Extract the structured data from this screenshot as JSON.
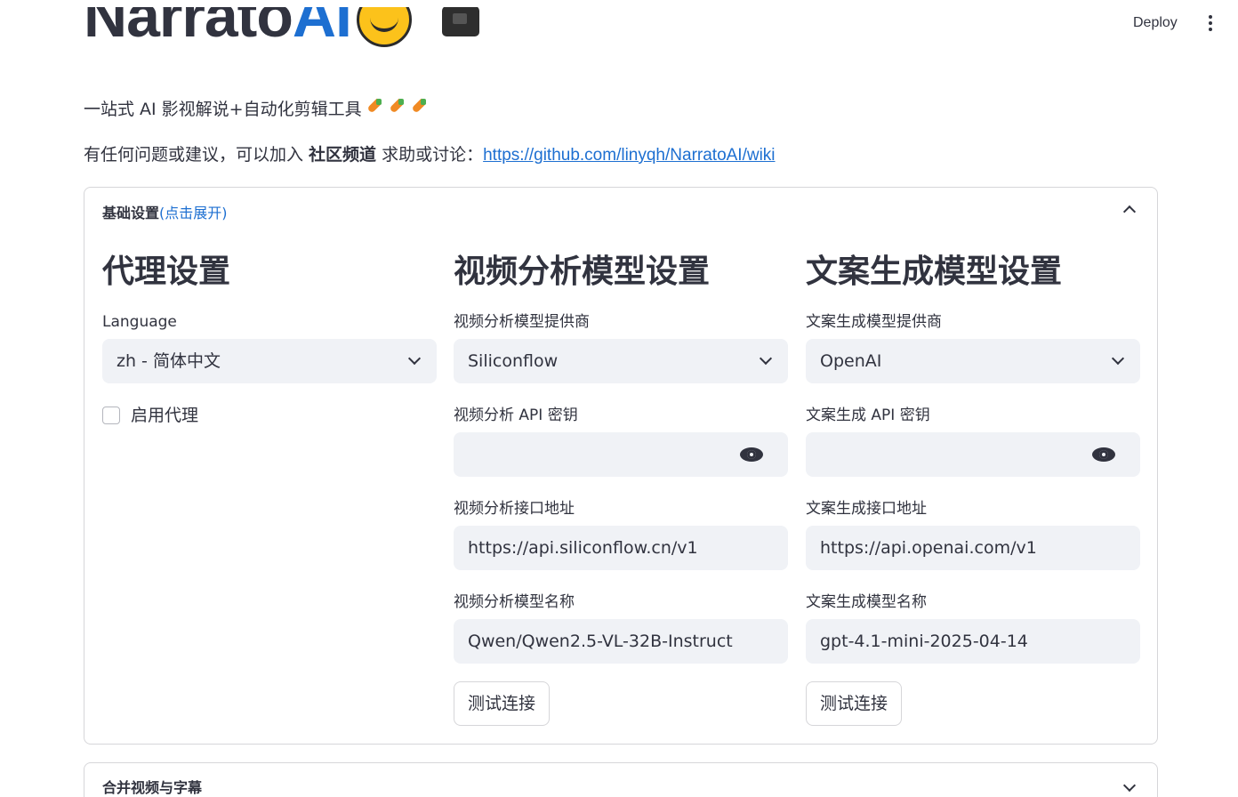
{
  "header": {
    "deploy_label": "Deploy"
  },
  "title": {
    "part1": "Narrato",
    "part2": "AI"
  },
  "subtitle": "一站式 AI 影视解说+自动化剪辑工具",
  "help": {
    "prefix": "有任何问题或建议，可以加入 ",
    "bold": "社区频道",
    "middle": " 求助或讨论：",
    "link": "https://github.com/linyqh/NarratoAI/wiki"
  },
  "basic_settings": {
    "title": "基础设置",
    "hint": "(点击展开)",
    "proxy": {
      "heading": "代理设置",
      "language_label": "Language",
      "language_value": "zh - 简体中文",
      "enable_proxy_label": "启用代理"
    },
    "video_model": {
      "heading": "视频分析模型设置",
      "provider_label": "视频分析模型提供商",
      "provider_value": "Siliconflow",
      "api_key_label": "视频分析 API 密钥",
      "api_key_value": "",
      "base_url_label": "视频分析接口地址",
      "base_url_value": "https://api.siliconflow.cn/v1",
      "model_name_label": "视频分析模型名称",
      "model_name_value": "Qwen/Qwen2.5-VL-32B-Instruct",
      "test_button": "测试连接"
    },
    "text_model": {
      "heading": "文案生成模型设置",
      "provider_label": "文案生成模型提供商",
      "provider_value": "OpenAI",
      "api_key_label": "文案生成 API 密钥",
      "api_key_value": "",
      "base_url_label": "文案生成接口地址",
      "base_url_value": "https://api.openai.com/v1",
      "model_name_label": "文案生成模型名称",
      "model_name_value": "gpt-4.1-mini-2025-04-14",
      "test_button": "测试连接"
    }
  },
  "merge_section": {
    "title": "合并视频与字幕"
  }
}
